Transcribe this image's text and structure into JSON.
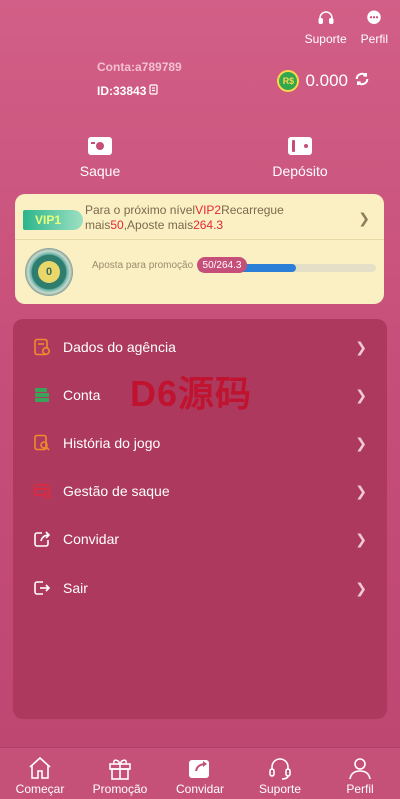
{
  "header": {
    "support_label": "Suporte",
    "profile_label": "Perfil"
  },
  "account": {
    "conta": "Conta:a789789",
    "id": "ID:33843"
  },
  "balance": {
    "currency_badge": "R$",
    "value": "0.000"
  },
  "actions": {
    "withdraw_label": "Saque",
    "deposit_label": "Depósito"
  },
  "vip": {
    "level": "VIP1",
    "text_1": "Para o próximo nível",
    "next_level": "VIP2",
    "text_2": "Recarregue mais",
    "recharge": "50",
    "text_3": ",Aposte mais",
    "bet": "264.3",
    "medal_value": "0",
    "bet_label": "Aposta para promoção",
    "progress_text": "50/264.3",
    "progress_fraction": 0.55
  },
  "menu": {
    "items": [
      {
        "label": "Dados do agência"
      },
      {
        "label": "Conta"
      },
      {
        "label": "História do jogo"
      },
      {
        "label": "Gestão de saque"
      },
      {
        "label": "Convidar"
      },
      {
        "label": "Sair"
      }
    ]
  },
  "watermark": "D6源码",
  "tabbar": {
    "tabs": [
      {
        "label": "Começar"
      },
      {
        "label": "Promoção"
      },
      {
        "label": "Convidar"
      },
      {
        "label": "Suporte"
      },
      {
        "label": "Perfil"
      }
    ]
  },
  "colors": {
    "background": "#c64f79",
    "menu_panel": "#ad3a5e",
    "vip_card": "#fbf0c3",
    "highlight_red": "#e2283b",
    "progress_blue": "#2c7fd6",
    "icon_orange": "#f08a2c",
    "icon_green": "#3aa35a",
    "icon_red": "#e2283b"
  }
}
